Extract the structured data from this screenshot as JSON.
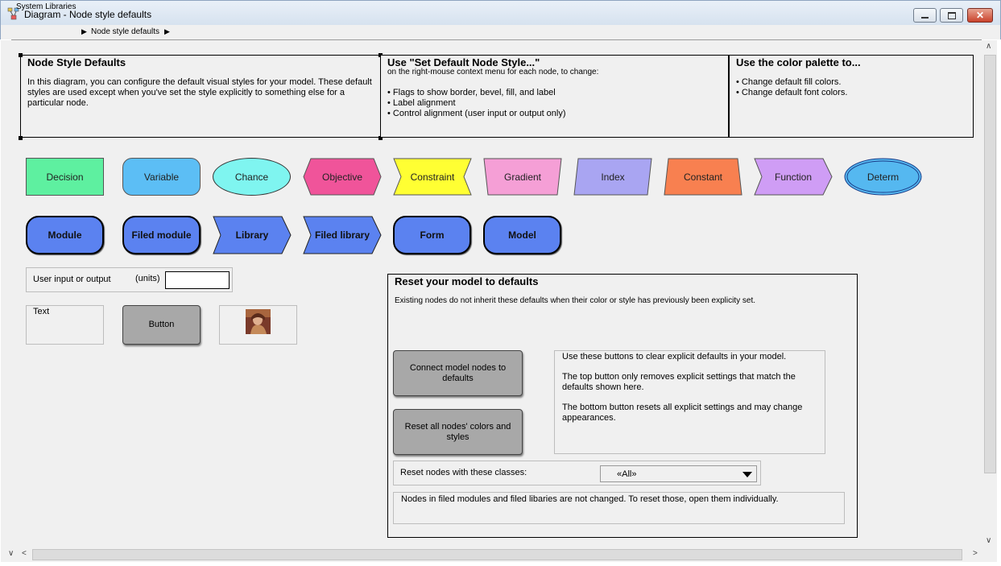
{
  "window": {
    "title": "Diagram - Node style defaults",
    "minimize": "–",
    "maximize": "□",
    "close": "✕"
  },
  "breadcrumb": [
    "System Libraries",
    "Node style defaults"
  ],
  "breadcrumb_sep": "▶",
  "header_boxes": [
    {
      "title": "Node Style Defaults",
      "body": "In this diagram, you can configure the default visual styles for your model.  These default styles are used except when you've set the style explicitly to something else for a particular node."
    },
    {
      "title": "Use \"Set Default Node Style...\"",
      "subtitle": "on the right-mouse context menu for each node, to change:",
      "bullets": [
        "• Flags to show border, bevel, fill, and label",
        "• Label alignment",
        "• Control alignment (user input or output only)"
      ]
    },
    {
      "title": "Use the color palette to...",
      "bullets": [
        "• Change default fill colors.",
        "• Change default font colors."
      ]
    }
  ],
  "nodes_row1": [
    {
      "label": "Decision",
      "color": "#5ef0a0"
    },
    {
      "label": "Variable",
      "color": "#5cbef5"
    },
    {
      "label": "Chance",
      "color": "#7ff5f0"
    },
    {
      "label": "Objective",
      "color": "#f0549a"
    },
    {
      "label": "Constraint",
      "color": "#ffff33"
    },
    {
      "label": "Gradient",
      "color": "#f59fd6"
    },
    {
      "label": "Index",
      "color": "#a9a5f2"
    },
    {
      "label": "Constant",
      "color": "#f88050"
    },
    {
      "label": "Function",
      "color": "#cf9df5"
    },
    {
      "label": "Determ",
      "color": "#55b8f0"
    }
  ],
  "nodes_row2": [
    {
      "label": "Module"
    },
    {
      "label": "Filed module"
    },
    {
      "label": "Library"
    },
    {
      "label": "Filed library"
    },
    {
      "label": "Form"
    },
    {
      "label": "Model"
    }
  ],
  "module_color": "#5b82f0",
  "user_io": {
    "label": "User input or output",
    "units": "(units)",
    "value": ""
  },
  "text_node": "Text",
  "button_node": "Button",
  "reset_panel": {
    "title": "Reset your model to defaults",
    "subtitle": "Existing nodes do not inherit these defaults when their color or style has previously been explicity set.",
    "connect_button": "Connect model nodes to defaults",
    "reset_button": "Reset all nodes' colors and styles",
    "help_lines": [
      "Use these buttons to clear explicit defaults in your model.",
      "The top button only removes explicit settings that match the defaults shown here.",
      "The bottom button resets all explicit settings and may change appearances."
    ],
    "classes_label": "Reset nodes with these classes:",
    "classes_value": "«All»",
    "note": "Nodes in filed modules and filed libaries are not changed. To reset those, open them individually."
  }
}
